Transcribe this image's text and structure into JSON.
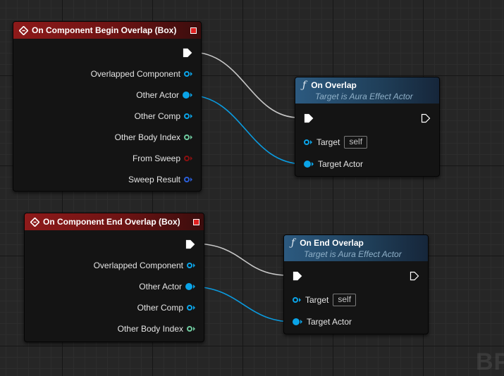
{
  "nodes": {
    "begin_overlap": {
      "title": "On Component Begin Overlap (Box)",
      "pins": {
        "overlapped_component": "Overlapped Component",
        "other_actor": "Other Actor",
        "other_comp": "Other Comp",
        "other_body_index": "Other Body Index",
        "from_sweep": "From Sweep",
        "sweep_result": "Sweep Result"
      }
    },
    "end_overlap": {
      "title": "On Component End Overlap (Box)",
      "pins": {
        "overlapped_component": "Overlapped Component",
        "other_actor": "Other Actor",
        "other_comp": "Other Comp",
        "other_body_index": "Other Body Index"
      }
    },
    "on_overlap": {
      "title": "On Overlap",
      "subtitle": "Target is Aura Effect Actor",
      "target_label": "Target",
      "target_value": "self",
      "target_actor_label": "Target Actor"
    },
    "on_end_overlap": {
      "title": "On End Overlap",
      "subtitle": "Target is Aura Effect Actor",
      "target_label": "Target",
      "target_value": "self",
      "target_actor_label": "Target Actor"
    }
  },
  "icons": {
    "event": "event-diamond-icon",
    "function": "function-f-icon",
    "close": "close-square-icon",
    "exec": "exec-pin-icon"
  },
  "colors": {
    "event_header": "#8e1a1a",
    "function_header": "#2c5a80",
    "object_pin": "#0aa4e8",
    "int_pin": "#6ec99e",
    "bool_pin": "#8a1010",
    "struct_pin": "#2b5fd8",
    "exec_wire": "#ffffff"
  },
  "watermark": "BP"
}
